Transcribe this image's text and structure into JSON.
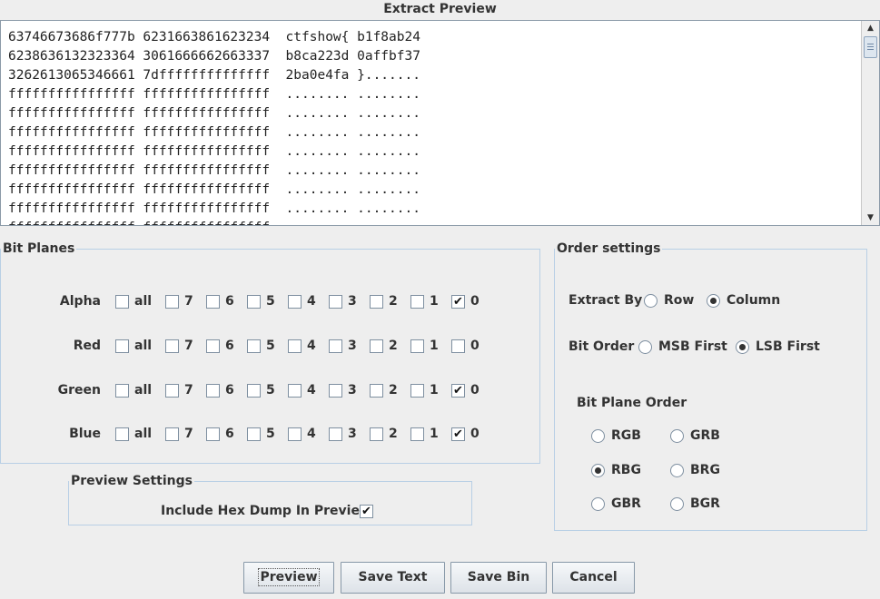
{
  "title": "Extract Preview",
  "preview_lines": [
    "63746673686f777b 6231663861623234  ctfshow{ b1f8ab24",
    "6238636132323364 3061666662663337  b8ca223d 0affbf37",
    "3262613065346661 7dffffffffffffff  2ba0e4fa }.......",
    "ffffffffffffffff ffffffffffffffff  ........ ........",
    "ffffffffffffffff ffffffffffffffff  ........ ........",
    "ffffffffffffffff ffffffffffffffff  ........ ........",
    "ffffffffffffffff ffffffffffffffff  ........ ........",
    "ffffffffffffffff ffffffffffffffff  ........ ........",
    "ffffffffffffffff ffffffffffffffff  ........ ........",
    "ffffffffffffffff ffffffffffffffff  ........ ........",
    "ffffffffffffffff ffffffffffffffff  ........ ........"
  ],
  "bit_planes": {
    "legend": "Bit Planes",
    "bit_labels": [
      "all",
      "7",
      "6",
      "5",
      "4",
      "3",
      "2",
      "1",
      "0"
    ],
    "channels": [
      {
        "name": "Alpha",
        "checked": [
          false,
          false,
          false,
          false,
          false,
          false,
          false,
          false,
          true
        ]
      },
      {
        "name": "Red",
        "checked": [
          false,
          false,
          false,
          false,
          false,
          false,
          false,
          false,
          false
        ]
      },
      {
        "name": "Green",
        "checked": [
          false,
          false,
          false,
          false,
          false,
          false,
          false,
          false,
          true
        ]
      },
      {
        "name": "Blue",
        "checked": [
          false,
          false,
          false,
          false,
          false,
          false,
          false,
          false,
          true
        ]
      }
    ]
  },
  "order_settings": {
    "legend": "Order settings",
    "extract_by": {
      "label": "Extract By",
      "options": [
        "Row",
        "Column"
      ],
      "selected": "Column"
    },
    "bit_order": {
      "label": "Bit Order",
      "options": [
        "MSB First",
        "LSB First"
      ],
      "selected": "LSB First"
    },
    "bit_plane_order": {
      "label": "Bit Plane Order",
      "options": [
        "RGB",
        "GRB",
        "RBG",
        "BRG",
        "GBR",
        "BGR"
      ],
      "selected": "RBG"
    }
  },
  "preview_settings": {
    "legend": "Preview Settings",
    "hex_dump_label": "Include Hex Dump In Preview",
    "hex_dump_checked": true
  },
  "buttons": {
    "preview": "Preview",
    "save_text": "Save Text",
    "save_bin": "Save Bin",
    "cancel": "Cancel"
  },
  "check_glyph": "✔"
}
